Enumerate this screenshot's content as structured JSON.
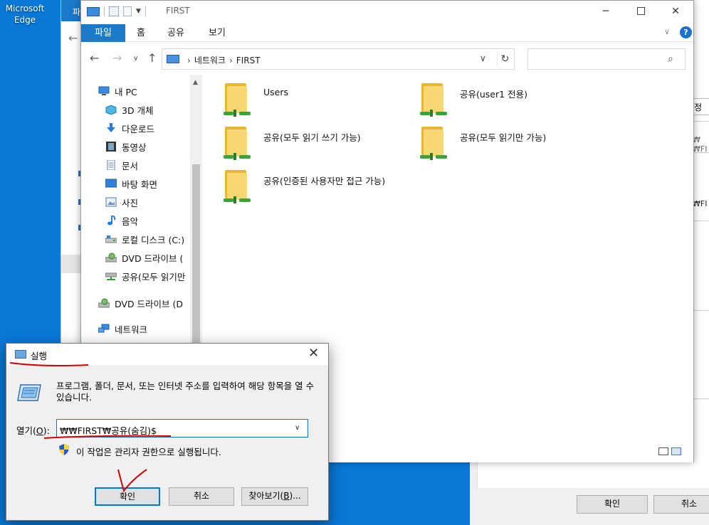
{
  "desktop": {
    "edge_label": "Microsoft Edge"
  },
  "bg_window": {
    "tab_label": "파"
  },
  "bg_dialog": {
    "tab_hint": "정",
    "text_top": "₩₩FI",
    "text_mid": "₩FI",
    "ok_label": "확인",
    "cancel_label": "취소"
  },
  "explorer": {
    "title": "FIRST",
    "ribbon_tabs": [
      "파일",
      "홈",
      "공유",
      "보기"
    ],
    "help_label": "?",
    "breadcrumb": [
      "네트워크",
      "FIRST"
    ],
    "nav_tree": [
      "내 PC",
      "3D 개체",
      "다운로드",
      "동영상",
      "문서",
      "바탕 화면",
      "사진",
      "음악",
      "로컬 디스크 (C:)",
      "DVD 드라이브 (",
      "공유(모두 읽기만",
      "DVD 드라이브 (D",
      "네트워크"
    ],
    "shares": [
      "Users",
      "공유(user1 전용)",
      "공유(모두 읽기  쓰기 가능)",
      "공유(모두 읽기만 가능)",
      "공유(인증된 사용자만 접근 가능)"
    ]
  },
  "run_dialog": {
    "title": "실행",
    "description": "프로그램, 폴더, 문서, 또는 인터넷 주소를 입력하여 해당 항목을 열 수 있습니다.",
    "open_label_pre": "열기(",
    "open_label_key": "O",
    "open_label_post": "):",
    "open_value": "₩₩FIRST₩공유(숨김)$",
    "admin_note": "이 작업은 관리자 권한으로 실행됩니다.",
    "ok_label": "확인",
    "cancel_label": "취소",
    "browse_label_pre": "찾아보기(",
    "browse_label_key": "B",
    "browse_label_post": ")..."
  },
  "icons": {
    "close": "close-icon",
    "minimize": "minimize-icon",
    "maximize": "maximize-icon",
    "search": "search-icon",
    "refresh": "refresh-icon",
    "shield": "uac-shield-icon"
  },
  "colors": {
    "desktop": "#0a78d7",
    "ribbon_file_tab": "#1979ca",
    "folder": "#f9d873",
    "annotation": "#d40000"
  }
}
